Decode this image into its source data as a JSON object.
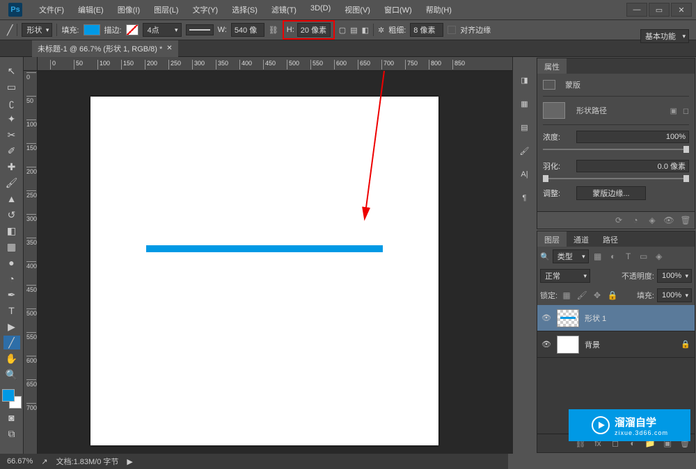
{
  "menu": {
    "items": [
      "文件(F)",
      "编辑(E)",
      "图像(I)",
      "图层(L)",
      "文字(Y)",
      "选择(S)",
      "滤镜(T)",
      "3D(D)",
      "视图(V)",
      "窗口(W)",
      "帮助(H)"
    ]
  },
  "options": {
    "shape_mode": "形状",
    "fill_label": "填充:",
    "stroke_label": "描边:",
    "stroke_width": "4点",
    "w_label": "W:",
    "w_value": "540 像",
    "h_label": "H:",
    "h_value": "20 像素",
    "weight_label": "粗细:",
    "weight_value": "8 像素",
    "align_label": "对齐边缘",
    "workspace": "基本功能"
  },
  "document": {
    "tab_title": "未标题-1 @ 66.7% (形状 1, RGB/8) *"
  },
  "ruler": {
    "h_ticks": [
      0,
      50,
      100,
      150,
      200,
      250,
      300,
      350,
      400,
      450,
      500,
      550,
      600,
      650,
      700,
      750,
      800,
      850
    ],
    "v_ticks": [
      0,
      50,
      100,
      150,
      200,
      250,
      300,
      350,
      400,
      450,
      500,
      550,
      600,
      650,
      700
    ]
  },
  "properties": {
    "panel_title": "属性",
    "mask_label": "蒙版",
    "shape_path_label": "形状路径",
    "density_label": "浓度:",
    "density_value": "100%",
    "feather_label": "羽化:",
    "feather_value": "0.0 像素",
    "adjust_label": "调整:",
    "mask_edge_label": "蒙版边缘..."
  },
  "layers": {
    "tabs": [
      "图层",
      "通道",
      "路径"
    ],
    "filter_label": "类型",
    "blend_mode": "正常",
    "opacity_label": "不透明度:",
    "opacity_value": "100%",
    "lock_label": "锁定:",
    "fill_label": "填充:",
    "fill_value": "100%",
    "items": [
      {
        "name": "形状 1",
        "active": true,
        "checkered": true
      },
      {
        "name": "背景",
        "active": false,
        "checkered": false
      }
    ]
  },
  "status": {
    "zoom": "66.67%",
    "doc_info": "文档:1.83M/0 字节"
  },
  "watermark": {
    "text1": "溜溜自学",
    "text2": "zixue.3d66.com"
  }
}
